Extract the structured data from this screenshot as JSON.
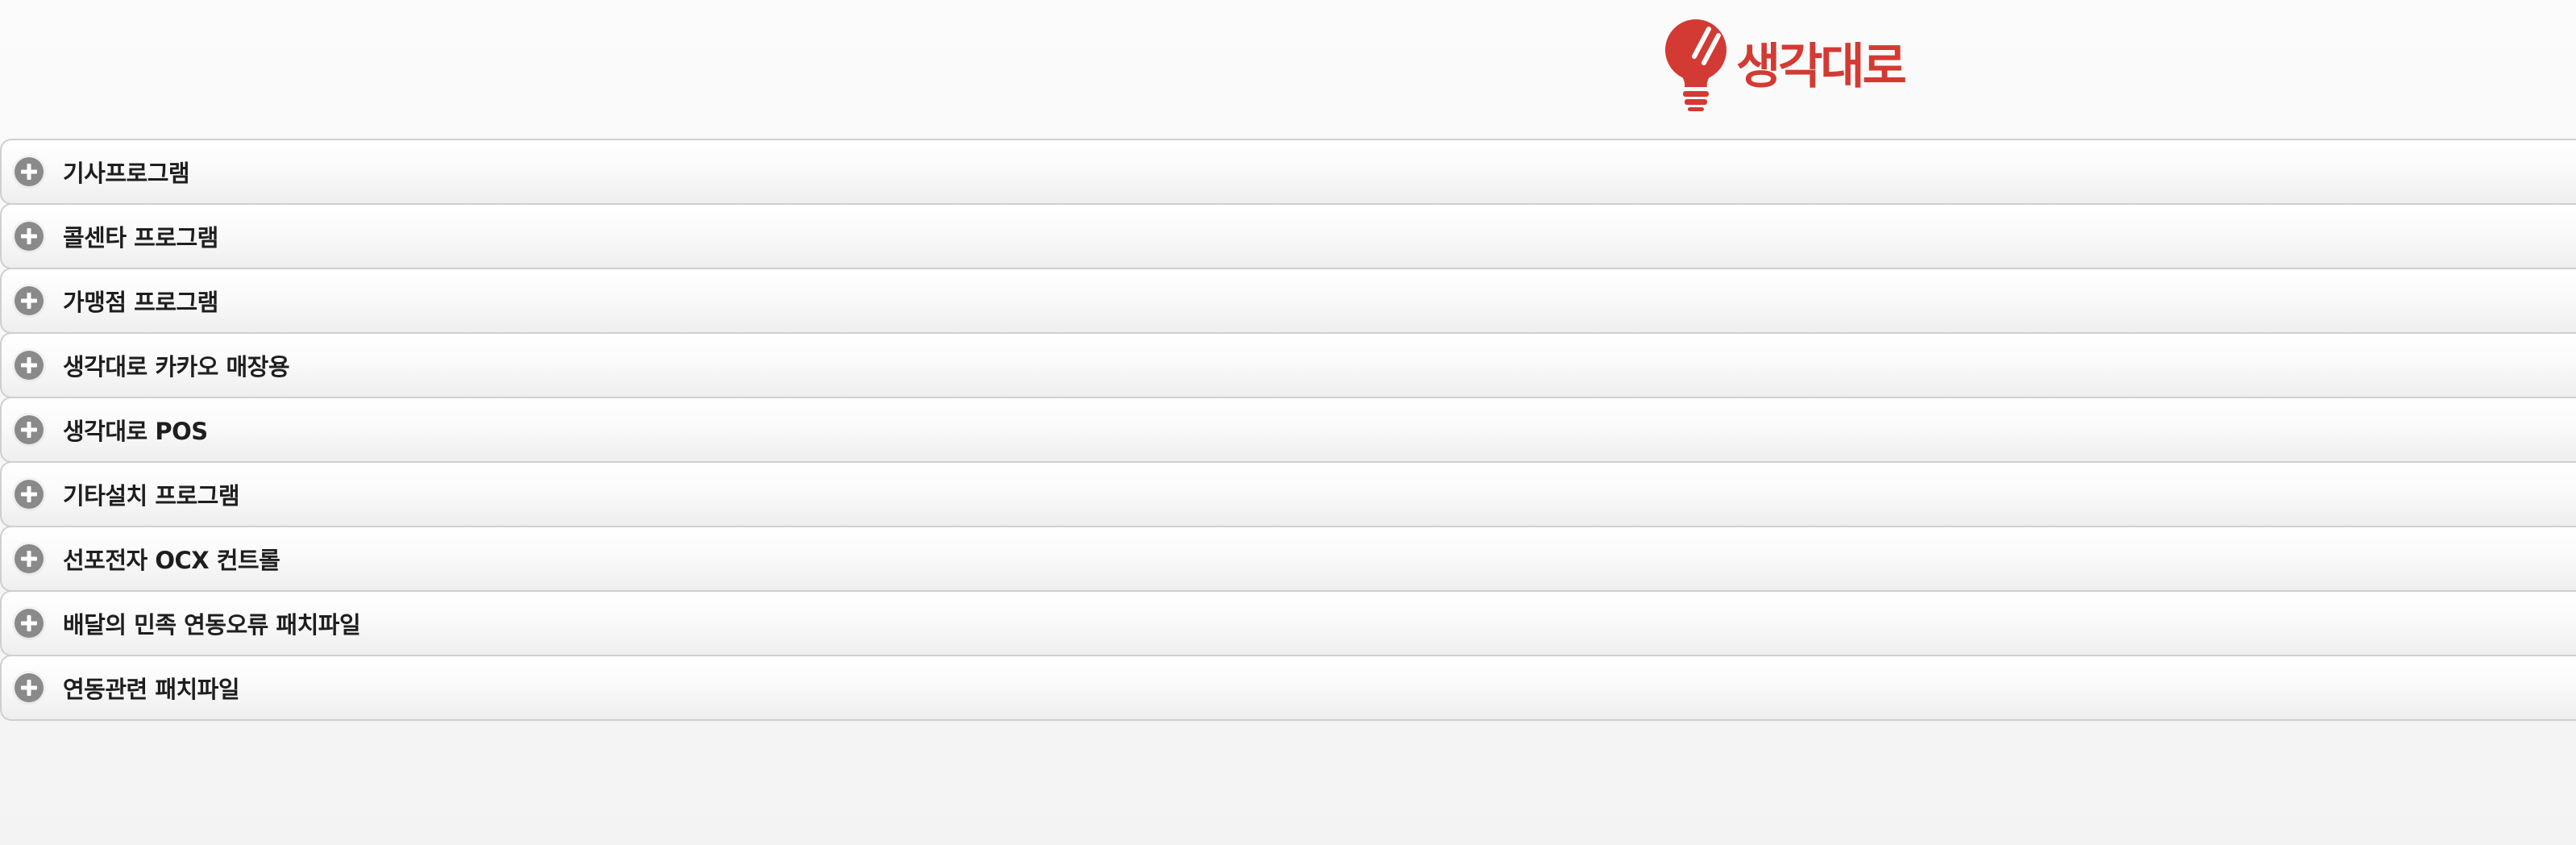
{
  "brand": {
    "name": "생각대로",
    "color": "#d33a33",
    "logo_icon": "lightbulb-icon"
  },
  "accordion": {
    "expand_icon": "plus-circle-icon",
    "items": [
      {
        "label": "기사프로그램"
      },
      {
        "label": "콜센타 프로그램"
      },
      {
        "label": "가맹점 프로그램"
      },
      {
        "label": "생각대로 카카오 매장용"
      },
      {
        "label": "생각대로 POS"
      },
      {
        "label": "기타설치 프로그램"
      },
      {
        "label": "선포전자 OCX 컨트롤"
      },
      {
        "label": "배달의 민족 연동오류 패치파일"
      },
      {
        "label": "연동관련 패치파일"
      }
    ]
  }
}
